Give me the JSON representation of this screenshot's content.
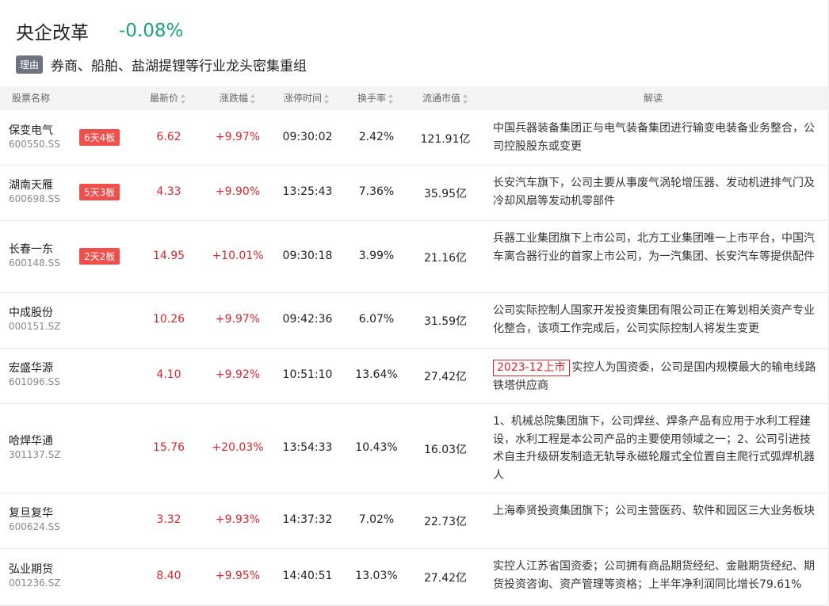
{
  "header": {
    "title": "央企改革",
    "change": "-0.08%"
  },
  "reason": {
    "badge": "理由",
    "text": "券商、船舶、盐湖提锂等行业龙头密集重组"
  },
  "columns": {
    "name": "股票名称",
    "price": "最新价",
    "change": "涨跌幅",
    "limit_time": "涨停时间",
    "turnover": "换手率",
    "market_cap": "流通市值",
    "analysis": "解读"
  },
  "rows": [
    {
      "name": "保变电气",
      "code": "600550.SS",
      "board": "6天4板",
      "price": "6.62",
      "change": "+9.97%",
      "time": "09:30:02",
      "turnover": "2.42%",
      "cap": "121.91亿",
      "tag": "",
      "desc": "中国兵器装备集团正与电气装备集团进行输变电装备业务整合，公司控股股东或变更"
    },
    {
      "name": "湖南天雁",
      "code": "600698.SS",
      "board": "5天3板",
      "price": "4.33",
      "change": "+9.90%",
      "time": "13:25:43",
      "turnover": "7.36%",
      "cap": "35.95亿",
      "tag": "",
      "desc": "长安汽车旗下，公司主要从事废气涡轮增压器、发动机进排气门及冷却风扇等发动机零部件"
    },
    {
      "name": "长春一东",
      "code": "600148.SS",
      "board": "2天2板",
      "price": "14.95",
      "change": "+10.01%",
      "time": "09:30:18",
      "turnover": "3.99%",
      "cap": "21.16亿",
      "tag": "",
      "desc": "兵器工业集团旗下上市公司，北方工业集团唯一上市平台，中国汽车离合器行业的首家上市公司，为一汽集团、长安汽车等提供配件"
    },
    {
      "name": "中成股份",
      "code": "000151.SZ",
      "board": "",
      "price": "10.26",
      "change": "+9.97%",
      "time": "09:42:36",
      "turnover": "6.07%",
      "cap": "31.59亿",
      "tag": "",
      "desc": "公司实际控制人国家开发投资集团有限公司正在筹划相关资产专业化整合，该项工作完成后，公司实际控制人将发生变更"
    },
    {
      "name": "宏盛华源",
      "code": "601096.SS",
      "board": "",
      "price": "4.10",
      "change": "+9.92%",
      "time": "10:51:10",
      "turnover": "13.64%",
      "cap": "27.42亿",
      "tag": "2023-12上市",
      "desc": "实控人为国资委，公司是国内规模最大的输电线路铁塔供应商"
    },
    {
      "name": "哈焊华通",
      "code": "301137.SZ",
      "board": "",
      "price": "15.76",
      "change": "+20.03%",
      "time": "13:54:33",
      "turnover": "10.43%",
      "cap": "16.03亿",
      "tag": "",
      "desc": "1、机械总院集团旗下，公司焊丝、焊条产品有应用于水利工程建设，水利工程是本公司产品的主要使用领域之一；2、公司引进技术自主升级研发制造无轨导永磁轮履式全位置自主爬行式弧焊机器人"
    },
    {
      "name": "复旦复华",
      "code": "600624.SS",
      "board": "",
      "price": "3.32",
      "change": "+9.93%",
      "time": "14:37:32",
      "turnover": "7.02%",
      "cap": "22.73亿",
      "tag": "",
      "desc": "上海奉贤投资集团旗下；公司主营医药、软件和园区三大业务板块"
    },
    {
      "name": "弘业期货",
      "code": "001236.SZ",
      "board": "",
      "price": "8.40",
      "change": "+9.95%",
      "time": "14:40:51",
      "turnover": "13.03%",
      "cap": "27.42亿",
      "tag": "",
      "desc": "实控人江苏省国资委；公司拥有商品期货经纪、金融期货经纪、期货投资咨询、资产管理等资格；上半年净利润同比增长79.61%"
    }
  ]
}
